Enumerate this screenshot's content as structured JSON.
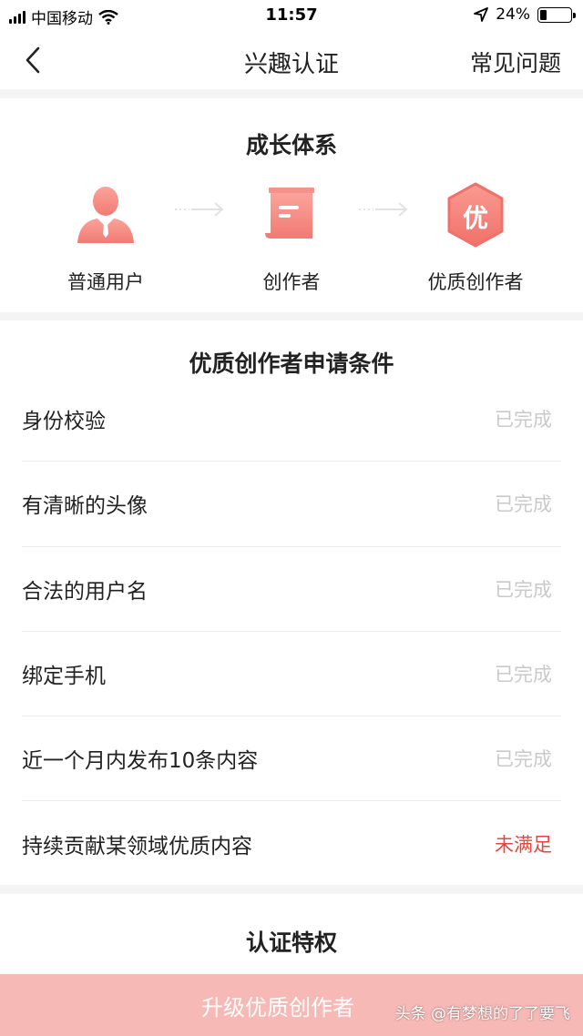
{
  "status_bar": {
    "carrier": "中国移动",
    "time": "11:57",
    "battery": "24%"
  },
  "nav": {
    "title": "兴趣认证",
    "faq": "常见问题"
  },
  "growth": {
    "title": "成长体系",
    "steps": [
      {
        "label": "普通用户",
        "icon": "person-icon"
      },
      {
        "label": "创作者",
        "icon": "document-icon"
      },
      {
        "label": "优质创作者",
        "icon": "quality-badge-icon",
        "badge_text": "优"
      }
    ]
  },
  "conditions": {
    "title": "优质创作者申请条件",
    "items": [
      {
        "label": "身份校验",
        "status": "已完成"
      },
      {
        "label": "有清晰的头像",
        "status": "已完成"
      },
      {
        "label": "合法的用户名",
        "status": "已完成"
      },
      {
        "label": "绑定手机",
        "status": "已完成"
      },
      {
        "label": "近一个月内发布10条内容",
        "status": "已完成"
      },
      {
        "label": "持续贡献某领域优质内容",
        "status": "未满足"
      }
    ]
  },
  "privileges": {
    "title": "认证特权"
  },
  "upgrade_button": {
    "label": "升级优质创作者"
  },
  "watermark": "头条 @有梦想的了了要飞",
  "colors": {
    "accent": "#f58a83",
    "unmet": "#e8453c",
    "button_bg": "#f7b9b6",
    "done": "#c9c9c9"
  }
}
